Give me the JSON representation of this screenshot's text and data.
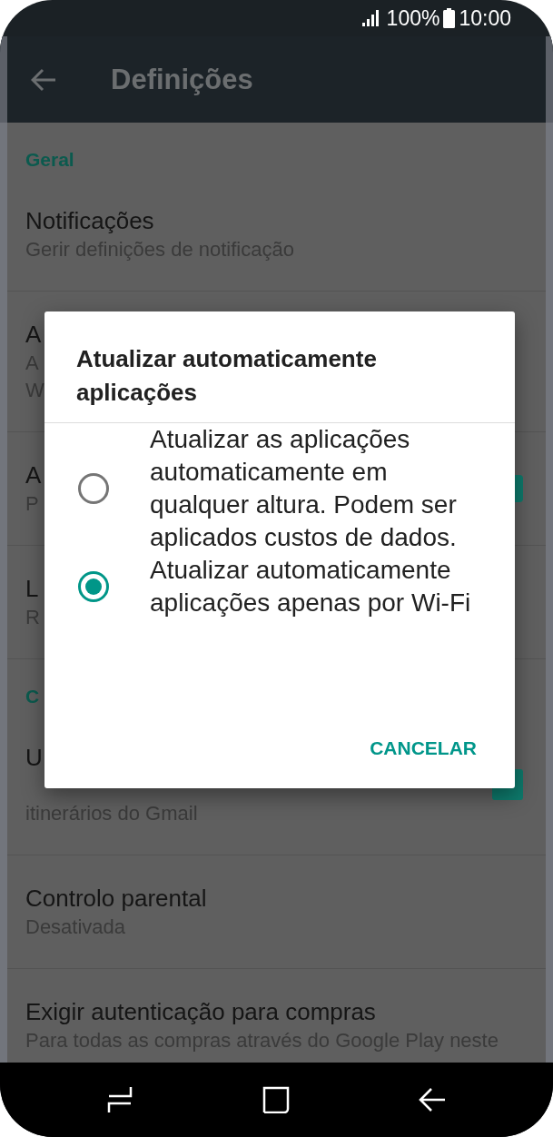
{
  "status_bar": {
    "battery": "100%",
    "time": "10:00"
  },
  "app_bar": {
    "title": "Definições"
  },
  "sections": [
    {
      "header": "Geral",
      "items": [
        {
          "kind": "plain",
          "title": "Notificações",
          "subtitle_lines": [
            "Gerir definições de notificação"
          ]
        },
        {
          "kind": "plain",
          "title": "A",
          "subtitle_lines": [
            "A",
            "W"
          ]
        },
        {
          "kind": "switch",
          "title": "A",
          "subtitle_lines": [
            "P"
          ],
          "on": true
        },
        {
          "kind": "plain",
          "title": "L",
          "subtitle_lines": [
            "R"
          ]
        }
      ]
    },
    {
      "header": "C",
      "items": [
        {
          "kind": "checkbox",
          "title": "U",
          "subtitle_lines": [
            "itinerários do Gmail"
          ],
          "checked": true
        },
        {
          "kind": "plain",
          "title": "Controlo parental",
          "subtitle_lines": [
            "Desativada"
          ]
        },
        {
          "kind": "plain",
          "title": "Exigir autenticação para compras",
          "subtitle_lines": [
            "Para todas as compras através do Google Play neste"
          ]
        }
      ]
    }
  ],
  "dialog": {
    "title": "Atualizar automaticamente aplicações",
    "options": [
      {
        "label": "Atualizar as aplicações automaticamente em qualquer altura. Podem ser aplicados custos de dados.",
        "selected": false
      },
      {
        "label": "Atualizar automaticamente aplicações apenas por Wi-Fi",
        "selected": true
      }
    ],
    "buttons": [
      "CANCELAR"
    ]
  }
}
